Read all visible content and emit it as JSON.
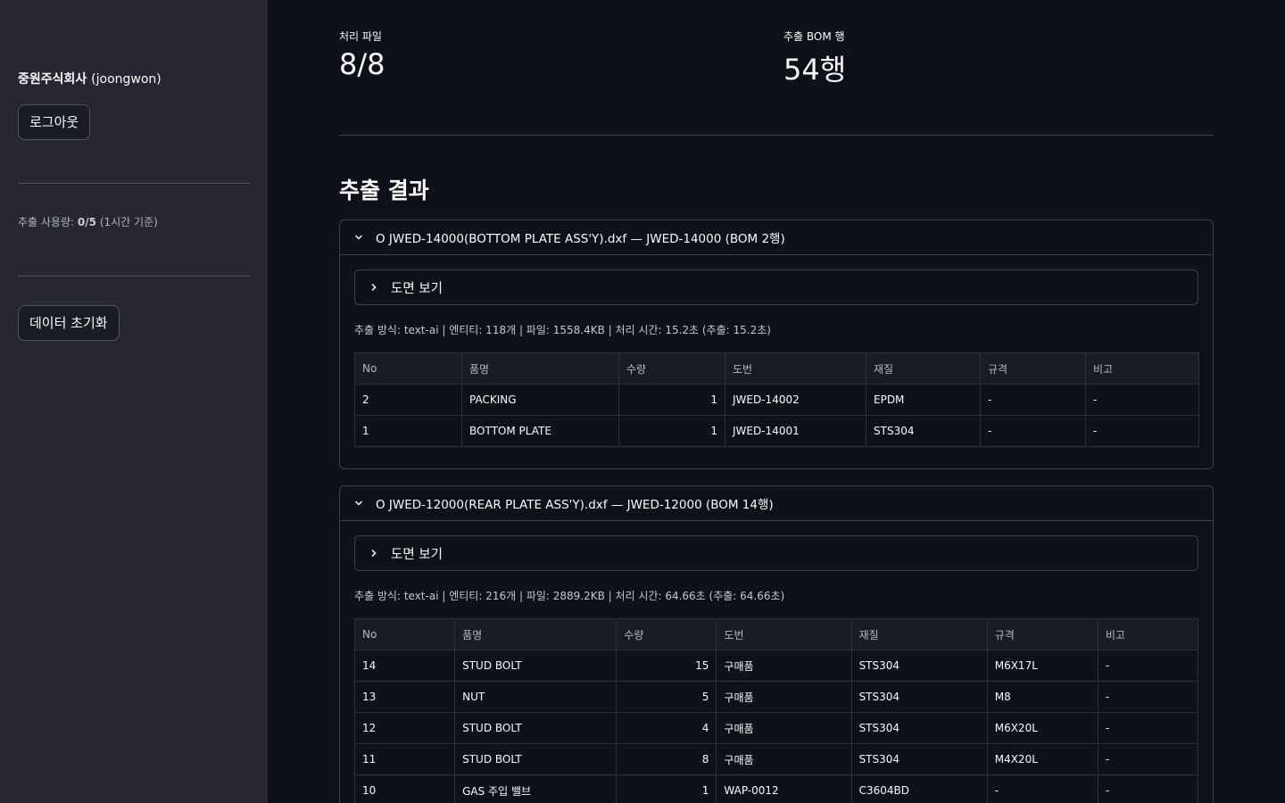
{
  "sidebar": {
    "company": "중원주식회사",
    "user_id": "(joongwon)",
    "logout_label": "로그아웃",
    "usage_label": "추출 사용량:",
    "usage_value": "0/5",
    "usage_note": "(1시간 기준)",
    "reset_label": "데이터 초기화"
  },
  "metrics": [
    {
      "label": "처리 파일",
      "value": "8/8"
    },
    {
      "label": "추출 BOM 행",
      "value": "54행"
    }
  ],
  "section_title": "추출 결과",
  "results": [
    {
      "header": "O JWED-14000(BOTTOM PLATE ASS'Y).dxf — JWED-14000 (BOM 2행)",
      "drawing_label": "도면 보기",
      "info": "추출 방식: text-ai | 엔티티: 118개 | 파일: 1558.4KB | 처리 시간: 15.2초 (추출: 15.2초)",
      "columns": [
        "No",
        "품명",
        "수량",
        "도번",
        "재질",
        "규격",
        "비고"
      ],
      "rows": [
        [
          "2",
          "PACKING",
          "1",
          "JWED-14002",
          "EPDM",
          "-",
          "-"
        ],
        [
          "1",
          "BOTTOM PLATE",
          "1",
          "JWED-14001",
          "STS304",
          "-",
          "-"
        ]
      ]
    },
    {
      "header": "O JWED-12000(REAR PLATE ASS'Y).dxf — JWED-12000 (BOM 14행)",
      "drawing_label": "도면 보기",
      "info": "추출 방식: text-ai | 엔티티: 216개 | 파일: 2889.2KB | 처리 시간: 64.66초 (추출: 64.66초)",
      "columns": [
        "No",
        "품명",
        "수량",
        "도번",
        "재질",
        "규격",
        "비고"
      ],
      "rows": [
        [
          "14",
          "STUD BOLT",
          "15",
          "구매품",
          "STS304",
          "M6X17L",
          "-"
        ],
        [
          "13",
          "NUT",
          "5",
          "구매품",
          "STS304",
          "M8",
          "-"
        ],
        [
          "12",
          "STUD BOLT",
          "4",
          "구매품",
          "STS304",
          "M6X20L",
          "-"
        ],
        [
          "11",
          "STUD BOLT",
          "8",
          "구매품",
          "STS304",
          "M4X20L",
          "-"
        ],
        [
          "10",
          "GAS 주입 밸브",
          "1",
          "WAP-0012",
          "C3604BD",
          "-",
          "-"
        ]
      ]
    }
  ]
}
